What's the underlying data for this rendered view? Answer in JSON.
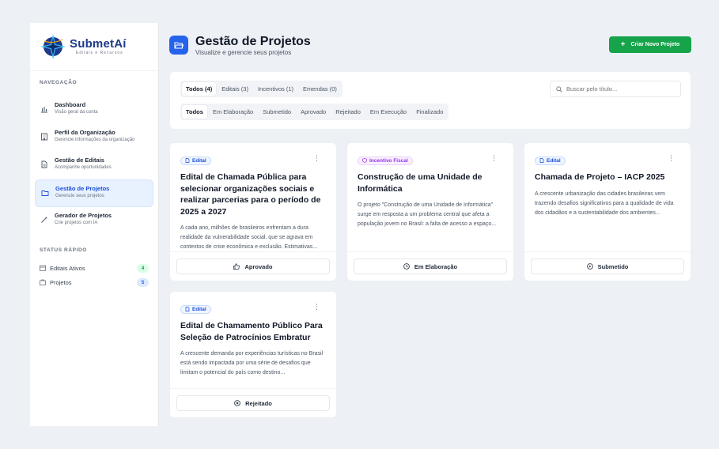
{
  "brand": {
    "name": "SubmetAí",
    "tagline": "Editais e Recursos"
  },
  "sidebar": {
    "nav_title": "NAVEGAÇÃO",
    "items": [
      {
        "label": "Dashboard",
        "desc": "Visão geral da conta",
        "icon": "bar-chart-icon"
      },
      {
        "label": "Perfil da Organização",
        "desc": "Gerencie informações da organização",
        "icon": "building-icon"
      },
      {
        "label": "Gestão de Editais",
        "desc": "Acompanhe oportunidades",
        "icon": "document-icon"
      },
      {
        "label": "Gestão de Projetos",
        "desc": "Gerencie seus projetos",
        "icon": "folder-icon"
      },
      {
        "label": "Gerador de Projetos",
        "desc": "Crie projetos com IA",
        "icon": "magic-wand-icon"
      }
    ],
    "status_title": "STATUS RÁPIDO",
    "status": [
      {
        "label": "Editais Ativos",
        "count": "4",
        "color": "#16a34a",
        "bg": "#dcfce7"
      },
      {
        "label": "Projetos",
        "count": "5",
        "color": "#2563eb",
        "bg": "#dbeafe"
      }
    ]
  },
  "header": {
    "title": "Gestão de Projetos",
    "subtitle": "Visualize e gerencie seus projetos",
    "create_label": "Criar Novo Projeto"
  },
  "filters": {
    "type_tabs": [
      "Todos (4)",
      "Editais (3)",
      "Incentivos (1)",
      "Emendas (0)"
    ],
    "status_tabs": [
      "Todos",
      "Em Elaboração",
      "Submetido",
      "Aprovado",
      "Rejeitado",
      "Em Execução",
      "Finalizado"
    ],
    "search_placeholder": "Buscar pelo título..."
  },
  "cards": [
    {
      "tag": "Edital",
      "title": "Edital de Chamada Pública para selecionar organizações sociais e realizar parcerias para o período de 2025 a 2027",
      "desc": "A cada ano, milhões de brasileiros enfrentam a dura realidade da vulnerabilidade social, que se agrava em contextos de crise econômica e exclusão. Estimativas...",
      "status": "Aprovado"
    },
    {
      "tag": "Incentivo Fiscal",
      "title": "Construção de uma Unidade de Informática",
      "desc": "O projeto \"Construção de uma Unidade de Informática\" surge em resposta a um problema central que afeta a população jovem no Brasil: a falta de acesso a espaço...",
      "status": "Em Elaboração"
    },
    {
      "tag": "Edital",
      "title": "Chamada de Projeto – IACP 2025",
      "desc": "A crescente urbanização das cidades brasileiras vem trazendo desafios significativos para a qualidade de vida dos cidadãos e a sustentabilidade dos ambientes...",
      "status": "Submetido"
    },
    {
      "tag": "Edital",
      "title": "Edital de Chamamento Público Para Seleção de Patrocínios Embratur",
      "desc": "A crescente demanda por experiências turísticas no Brasil está sendo impactada por uma série de desafios que limitam o potencial do país como destino...",
      "status": "Rejeitado"
    }
  ],
  "colors": {
    "primary": "#2563eb",
    "success": "#16a34a",
    "fiscal": "#9333ea"
  }
}
